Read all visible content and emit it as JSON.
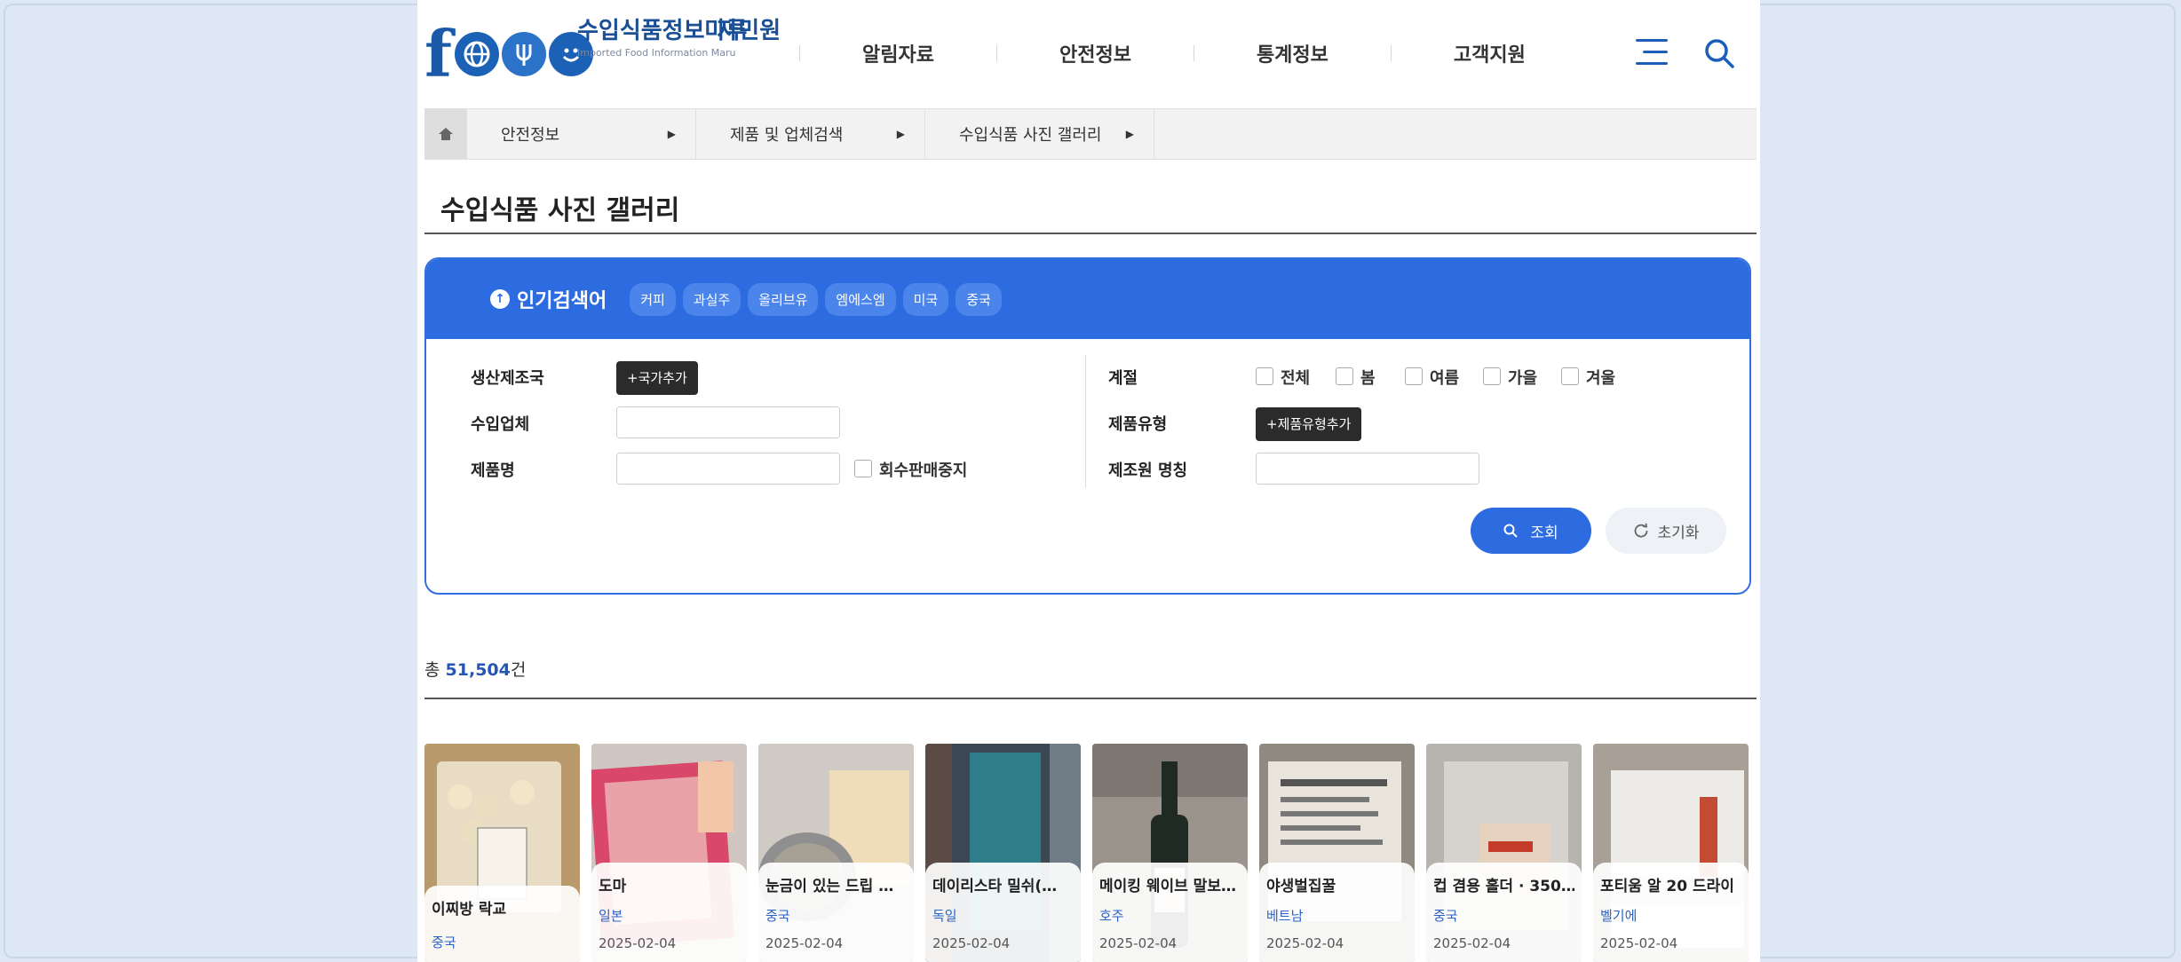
{
  "logo": {
    "title": "수입식품정보마루",
    "subtitle": "Imported Food Information Maru",
    "overlap_text": "자민원"
  },
  "nav": [
    "알림자료",
    "안전정보",
    "통계정보",
    "고객지원"
  ],
  "breadcrumb": [
    "안전정보",
    "제품 및 업체검색",
    "수입식품 사진 갤러리"
  ],
  "page_title": "수입식품 사진 갤러리",
  "popular": {
    "label": "인기검색어",
    "keywords": [
      "커피",
      "과실주",
      "올리브유",
      "엠에스엠",
      "미국",
      "중국"
    ]
  },
  "form": {
    "country_label": "생산제조국",
    "country_button": "+국가추가",
    "importer_label": "수입업체",
    "importer_value": "",
    "product_label": "제품명",
    "product_value": "",
    "recall_label": "회수판매중지",
    "season_label": "계절",
    "seasons": [
      "전체",
      "봄",
      "여름",
      "가을",
      "겨울"
    ],
    "type_label": "제품유형",
    "type_button": "+제품유형추가",
    "material_label": "제조원 명칭",
    "material_value": ""
  },
  "buttons": {
    "search": "조회",
    "reset": "초기화"
  },
  "total": {
    "prefix": "총 ",
    "count": "51,504",
    "suffix": "건"
  },
  "items": [
    {
      "title": "이찌방 락교",
      "country": "중국",
      "date": ""
    },
    {
      "title": "도마",
      "country": "일본",
      "date": "2025-02-04"
    },
    {
      "title": "눈금이 있는 드립 …",
      "country": "중국",
      "date": "2025-02-04"
    },
    {
      "title": "데이리스타 밀쉬(…",
      "country": "독일",
      "date": "2025-02-04"
    },
    {
      "title": "메이킹 웨이브 말보…",
      "country": "호주",
      "date": "2025-02-04"
    },
    {
      "title": "야생벌집꿀",
      "country": "베트남",
      "date": "2025-02-04"
    },
    {
      "title": "컵 겸용 홀더 · 350…",
      "country": "중국",
      "date": "2025-02-04"
    },
    {
      "title": "포티움 알 20 드라이",
      "country": "벨기에",
      "date": "2025-02-04"
    }
  ],
  "colors": {
    "primary": "#2d6be0",
    "brand": "#1a5aa8",
    "background": "#dde8f4"
  }
}
